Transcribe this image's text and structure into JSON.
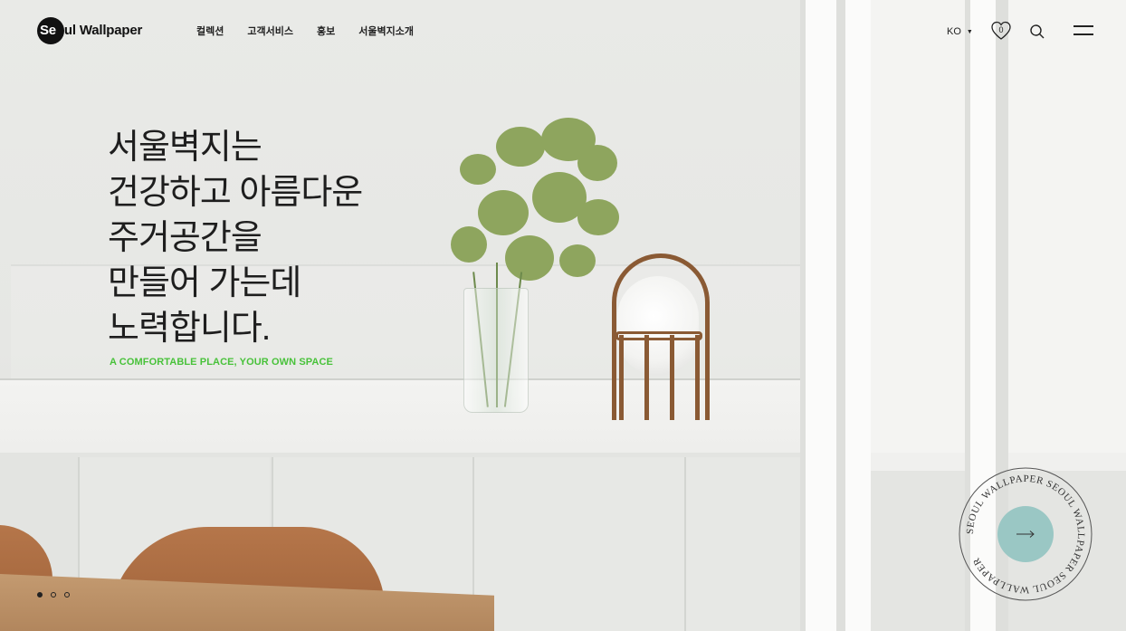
{
  "header": {
    "logo": {
      "part1": "Se",
      "part2": "oul Wallpaper"
    },
    "nav": [
      "컬렉션",
      "고객서비스",
      "홍보",
      "서울벽지소개"
    ],
    "language": "KO",
    "wishlist_count": "0"
  },
  "hero": {
    "headline": [
      "서울벽지는",
      "건강하고 아름다운",
      "주거공간을",
      "만들어 가는데",
      "노력합니다."
    ],
    "tagline": "A COMFORTABLE PLACE, YOUR OWN SPACE",
    "badge_text": "SEOUL WALLPAPER SEOUL WALLPAPER SEOUL WALLPAPER ",
    "slides": {
      "total": 3,
      "active": 1
    }
  },
  "colors": {
    "accent_green": "#48c23a",
    "badge_teal": "#9ac7c4"
  },
  "icons": [
    "heart-icon",
    "search-icon",
    "hamburger-menu-icon",
    "arrow-right-icon",
    "caret-down-icon"
  ]
}
